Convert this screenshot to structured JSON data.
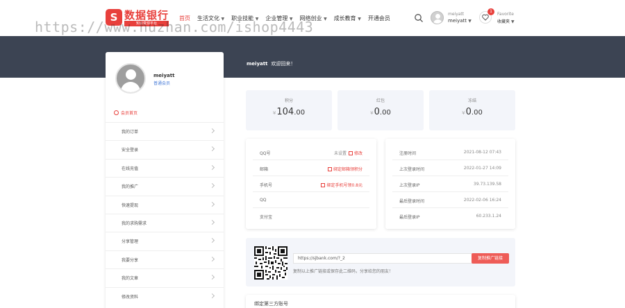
{
  "header": {
    "logo_text": "数据银行",
    "logo_sub": "知识变现平台",
    "nav": [
      {
        "label": "首页",
        "active": true,
        "dropdown": false
      },
      {
        "label": "生活文化",
        "active": false,
        "dropdown": true
      },
      {
        "label": "职业技能",
        "active": false,
        "dropdown": true
      },
      {
        "label": "企业管理",
        "active": false,
        "dropdown": true
      },
      {
        "label": "网络创业",
        "active": false,
        "dropdown": true
      },
      {
        "label": "成长教育",
        "active": false,
        "dropdown": true
      },
      {
        "label": "开通会员",
        "active": false,
        "dropdown": false
      }
    ],
    "user_small": "meiyatt",
    "user_name": "meiyatt",
    "fav_small": "Favorite",
    "fav_label": "收藏夹",
    "fav_count": "1"
  },
  "watermark": "https://www.huzhan.com/ishop4443",
  "banner": {
    "username": "meiyatt",
    "greeting": "欢迎回来！"
  },
  "sidebar": {
    "name": "meiyatt",
    "level": "普通会员",
    "home": "会员首页",
    "items": [
      "我的订单",
      "安全登录",
      "在线充值",
      "我的推广",
      "快速提现",
      "我的求购需求",
      "分享管理",
      "我要分享",
      "我的文章",
      "修改资料"
    ]
  },
  "stats": [
    {
      "label": "积分",
      "currency": "¥",
      "int": "104",
      "dec": ".00"
    },
    {
      "label": "红包",
      "currency": "¥",
      "int": "0",
      "dec": ".00"
    },
    {
      "label": "冻结",
      "currency": "¥",
      "int": "0",
      "dec": ".00"
    }
  ],
  "account_info": [
    {
      "key": "QQ号",
      "value": "未设置",
      "action": "修改"
    },
    {
      "key": "邮箱",
      "value": "",
      "action": "绑定邮箱领积分"
    },
    {
      "key": "手机号",
      "value": "",
      "action": "绑定手机号领0.8元"
    },
    {
      "key": "QQ",
      "value": "",
      "action": ""
    },
    {
      "key": "支付宝",
      "value": "",
      "action": ""
    }
  ],
  "login_info": [
    {
      "key": "注册时间",
      "value": "2021-08-12 07:43"
    },
    {
      "key": "上次登录时间",
      "value": "2022-01-27 14:09"
    },
    {
      "key": "上次登录IP",
      "value": "39.73.139.58"
    },
    {
      "key": "最后登录时间",
      "value": "2022-02-06 16:24"
    },
    {
      "key": "最后登录IP",
      "value": "60.233.1.24"
    }
  ],
  "promo": {
    "link": "https://sjbank.com/?_2",
    "copy_label": "复制推广链接",
    "tip": "复制以上推广链接或保存此二维码，分享给您的朋友！"
  },
  "third_party": {
    "title": "绑定第三方账号"
  },
  "colors": {
    "accent": "#e8403c",
    "banner": "#3c4453",
    "card_bg": "#f3f5fa"
  }
}
